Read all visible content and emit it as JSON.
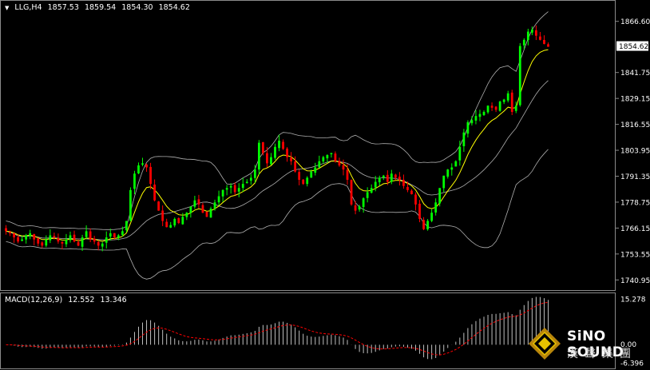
{
  "header": {
    "triangle": "▼",
    "symbol": "LLG,H4",
    "open": "1857.53",
    "high": "1859.54",
    "low": "1854.30",
    "close": "1854.62"
  },
  "macd_header": {
    "label": "MACD(12,26,9)",
    "main": "12.552",
    "signal": "13.346"
  },
  "logo": {
    "en": "SiNO SOUND",
    "cn": "漢聲集團"
  },
  "colors": {
    "background": "#000000",
    "bull": "#00ff00",
    "bear": "#ff0000",
    "bollinger": "#b0b0b0",
    "ma": "#ffff00",
    "macd_hist": "#c0c0c0",
    "macd_signal": "#ff0000",
    "grid": "#8a8a8a"
  },
  "chart_data": [
    {
      "type": "candlestick",
      "symbol": "LLG",
      "timeframe": "H4",
      "ylim": [
        1736.4,
        1876.2
      ],
      "yticks": [
        "1866.60",
        "1854.62",
        "1841.75",
        "1829.15",
        "1816.55",
        "1803.95",
        "1791.35",
        "1778.75",
        "1766.15",
        "1753.55",
        "1740.95"
      ],
      "current_price": "1854.62",
      "overlays": [
        "Bollinger Bands",
        "Moving Average"
      ],
      "series": [
        {
          "name": "price",
          "closes": [
            1765,
            1764,
            1762,
            1760,
            1761,
            1763,
            1764,
            1761,
            1759,
            1758,
            1761,
            1763,
            1762,
            1760,
            1759,
            1761,
            1763,
            1760,
            1758,
            1762,
            1765,
            1761,
            1760,
            1758,
            1759,
            1762,
            1764,
            1762,
            1763,
            1765,
            1770,
            1785,
            1793,
            1797,
            1798,
            1796,
            1788,
            1780,
            1775,
            1770,
            1767,
            1768,
            1771,
            1769,
            1772,
            1774,
            1777,
            1780,
            1778,
            1774,
            1772,
            1776,
            1779,
            1782,
            1785,
            1786,
            1787,
            1784,
            1786,
            1788,
            1789,
            1791,
            1795,
            1808,
            1803,
            1798,
            1801,
            1806,
            1809,
            1805,
            1801,
            1799,
            1794,
            1790,
            1788,
            1791,
            1794,
            1796,
            1799,
            1801,
            1802,
            1803,
            1799,
            1797,
            1795,
            1790,
            1778,
            1775,
            1777,
            1781,
            1784,
            1786,
            1789,
            1791,
            1792,
            1789,
            1793,
            1791,
            1790,
            1787,
            1785,
            1783,
            1778,
            1771,
            1766,
            1770,
            1774,
            1779,
            1786,
            1792,
            1795,
            1796,
            1799,
            1806,
            1813,
            1818,
            1819,
            1821,
            1822,
            1823,
            1826,
            1825,
            1824,
            1828,
            1829,
            1832,
            1823,
            1826,
            1855,
            1858,
            1862,
            1863,
            1860,
            1858,
            1856,
            1854.62
          ]
        },
        {
          "name": "macd_histogram",
          "ylim": [
            -6.396,
            15.278
          ]
        },
        {
          "name": "macd_signal"
        }
      ],
      "macd_yticks": [
        "15.278",
        "0.00",
        "-6.396"
      ]
    }
  ]
}
